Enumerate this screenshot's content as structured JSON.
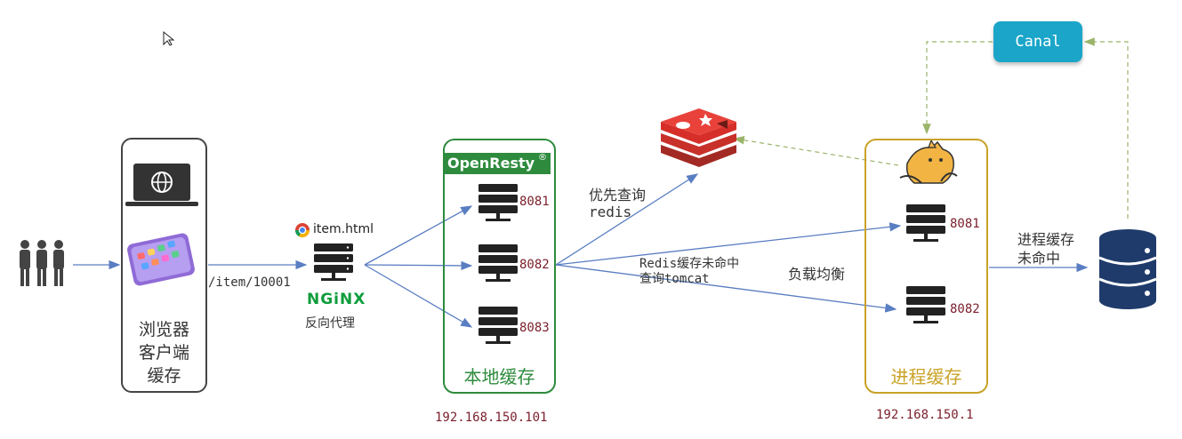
{
  "browser": {
    "label_lines": [
      "浏览器",
      "客户端",
      "缓存"
    ],
    "request_path": "/item/10001"
  },
  "nginx": {
    "page": "item.html",
    "logo_text": "NGiNX",
    "role": "反向代理"
  },
  "openresty": {
    "brand": "OpenResty",
    "ports": [
      "8081",
      "8082",
      "8083"
    ],
    "label": "本地缓存",
    "ip": "192.168.150.101"
  },
  "redis": {
    "query_line1": "优先查询",
    "query_line2": "redis"
  },
  "tomcat": {
    "miss_line1": "Redis缓存未命中",
    "miss_line2": "查询tomcat",
    "balance": "负载均衡",
    "ports": [
      "8081",
      "8082"
    ],
    "label": "进程缓存",
    "ip": "192.168.150.1"
  },
  "db": {
    "miss_line1": "进程缓存",
    "miss_line2": "未命中"
  },
  "canal": {
    "label": "Canal"
  },
  "colors": {
    "openresty_border": "#2e8b3d",
    "tomcat_border": "#c9a227",
    "canal_bg": "#1aa5c9",
    "redis": "#d62f2a",
    "arrow": "#5a7ec2",
    "db": "#1f3b6b",
    "port_text": "#7a1f2b"
  }
}
